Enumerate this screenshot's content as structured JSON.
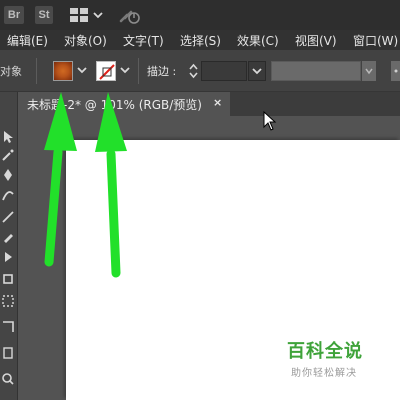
{
  "appbar": {
    "bridge_label": "Br",
    "stock_label": "St"
  },
  "menu": {
    "items": [
      "编辑(E)",
      "对象(O)",
      "文字(T)",
      "选择(S)",
      "效果(C)",
      "视图(V)",
      "窗口(W)"
    ]
  },
  "control": {
    "object_label": "对象",
    "stroke_label": "描边 :",
    "fill_color": "#b8531a",
    "stroke_color": "none"
  },
  "document": {
    "tab_title": "未标题-2* @ 101% (RGB/预览)",
    "close_glyph": "×"
  },
  "annotation": {
    "arrow_color": "#22e02a"
  },
  "watermark": {
    "title": "百科全说",
    "subtitle": "助你轻松解决"
  }
}
